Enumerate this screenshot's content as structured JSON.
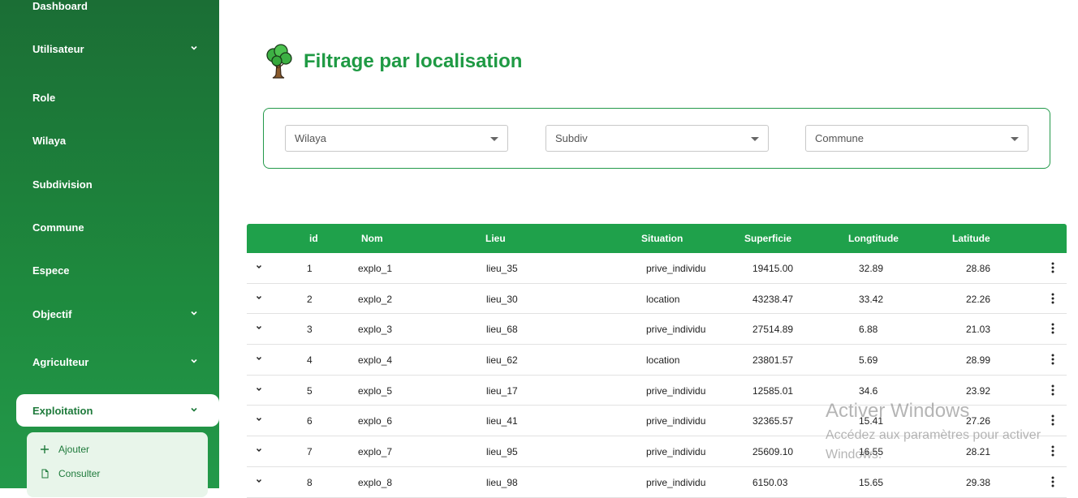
{
  "sidebar": {
    "items": [
      {
        "label": "Dashboard"
      },
      {
        "label": "Utilisateur"
      },
      {
        "label": "Role"
      },
      {
        "label": "Wilaya"
      },
      {
        "label": "Subdivision"
      },
      {
        "label": "Commune"
      },
      {
        "label": "Espece"
      },
      {
        "label": "Objectif"
      },
      {
        "label": "Agriculteur"
      },
      {
        "label": "Exploitation"
      }
    ],
    "submenu": [
      {
        "label": "Ajouter",
        "icon": "plus-icon"
      },
      {
        "label": "Consulter",
        "icon": "document-icon"
      }
    ]
  },
  "page": {
    "title": "Filtrage par localisation",
    "icon": "tree-icon"
  },
  "filters": {
    "wilaya": "Wilaya",
    "subdiv": "Subdiv",
    "commune": "Commune"
  },
  "table": {
    "headers": [
      "id",
      "Nom",
      "Lieu",
      "Situation",
      "Superficie",
      "Longtitude",
      "Latitude"
    ],
    "rows": [
      {
        "id": "1",
        "nom": "explo_1",
        "lieu": "lieu_35",
        "situation": "prive_individu",
        "superficie": "19415.00",
        "longtitude": "32.89",
        "latitude": "28.86"
      },
      {
        "id": "2",
        "nom": "explo_2",
        "lieu": "lieu_30",
        "situation": "location",
        "superficie": "43238.47",
        "longtitude": "33.42",
        "latitude": "22.26"
      },
      {
        "id": "3",
        "nom": "explo_3",
        "lieu": "lieu_68",
        "situation": "prive_individu",
        "superficie": "27514.89",
        "longtitude": "6.88",
        "latitude": "21.03"
      },
      {
        "id": "4",
        "nom": "explo_4",
        "lieu": "lieu_62",
        "situation": "location",
        "superficie": "23801.57",
        "longtitude": "5.69",
        "latitude": "28.99"
      },
      {
        "id": "5",
        "nom": "explo_5",
        "lieu": "lieu_17",
        "situation": "prive_individu",
        "superficie": "12585.01",
        "longtitude": "34.6",
        "latitude": "23.92"
      },
      {
        "id": "6",
        "nom": "explo_6",
        "lieu": "lieu_41",
        "situation": "prive_individu",
        "superficie": "32365.57",
        "longtitude": "15.41",
        "latitude": "27.26"
      },
      {
        "id": "7",
        "nom": "explo_7",
        "lieu": "lieu_95",
        "situation": "prive_individu",
        "superficie": "25609.10",
        "longtitude": "16.55",
        "latitude": "28.21"
      },
      {
        "id": "8",
        "nom": "explo_8",
        "lieu": "lieu_98",
        "situation": "prive_individu",
        "superficie": "6150.03",
        "longtitude": "15.65",
        "latitude": "29.38"
      }
    ]
  },
  "watermark": {
    "line1": "Activer Windows",
    "line2": "Accédez aux paramètres pour activer Windows."
  },
  "colors": {
    "brand": "#1fa14b",
    "sidebar": "#1b6e35",
    "title": "#1f9a44"
  }
}
